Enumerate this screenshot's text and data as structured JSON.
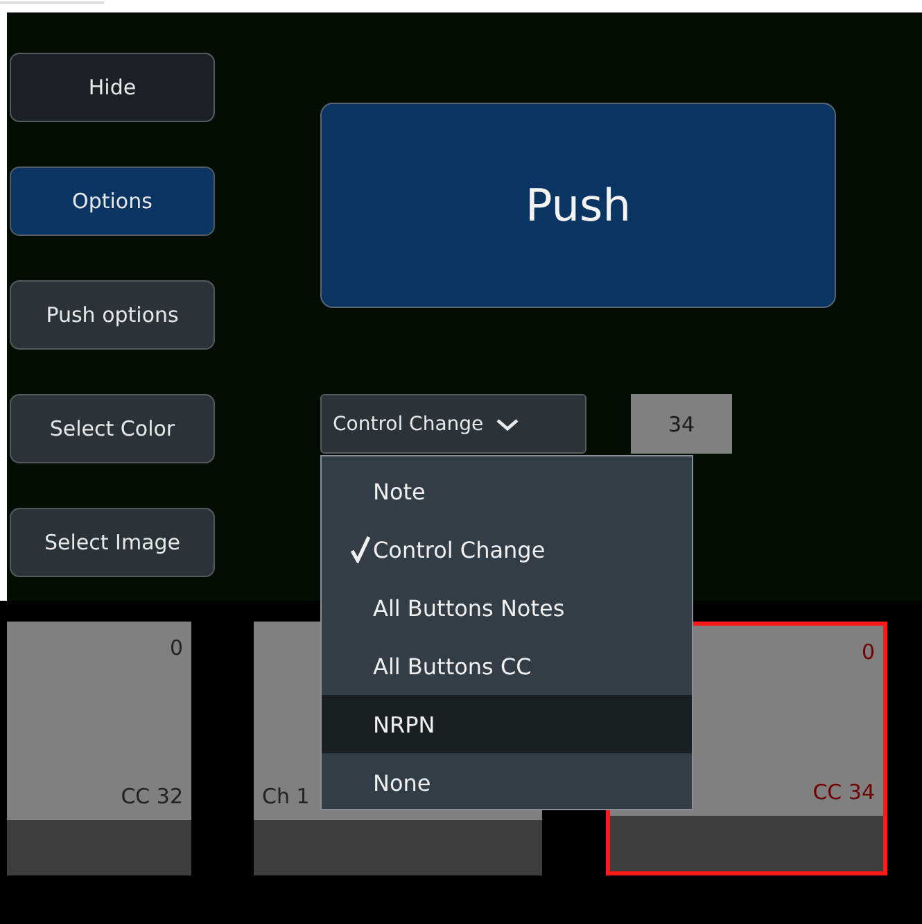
{
  "side_buttons": [
    {
      "label": "Hide",
      "kind": "dark",
      "selected": false
    },
    {
      "label": "Options",
      "kind": "normal",
      "selected": true
    },
    {
      "label": "Push options",
      "kind": "normal",
      "selected": false
    },
    {
      "label": "Select Color",
      "kind": "normal",
      "selected": false
    },
    {
      "label": "Select Image",
      "kind": "normal",
      "selected": false
    }
  ],
  "push_button": {
    "label": "Push"
  },
  "type_dropdown": {
    "value": "Control Change",
    "expanded": true
  },
  "number_field": {
    "value": "34"
  },
  "dropdown_menu": [
    {
      "label": "Note",
      "checked": false,
      "highlighted": false
    },
    {
      "label": "Control Change",
      "checked": true,
      "highlighted": false
    },
    {
      "label": "All Buttons Notes",
      "checked": false,
      "highlighted": false
    },
    {
      "label": "All Buttons CC",
      "checked": false,
      "highlighted": false
    },
    {
      "label": "NRPN",
      "checked": false,
      "highlighted": true
    },
    {
      "label": "None",
      "checked": false,
      "highlighted": false
    }
  ],
  "pads": [
    {
      "value": "0",
      "label": "CC 32",
      "selected": false
    },
    {
      "label": "Ch 1",
      "selected": false
    },
    {
      "value": "0",
      "label": "CC 34",
      "selected": true
    }
  ]
}
